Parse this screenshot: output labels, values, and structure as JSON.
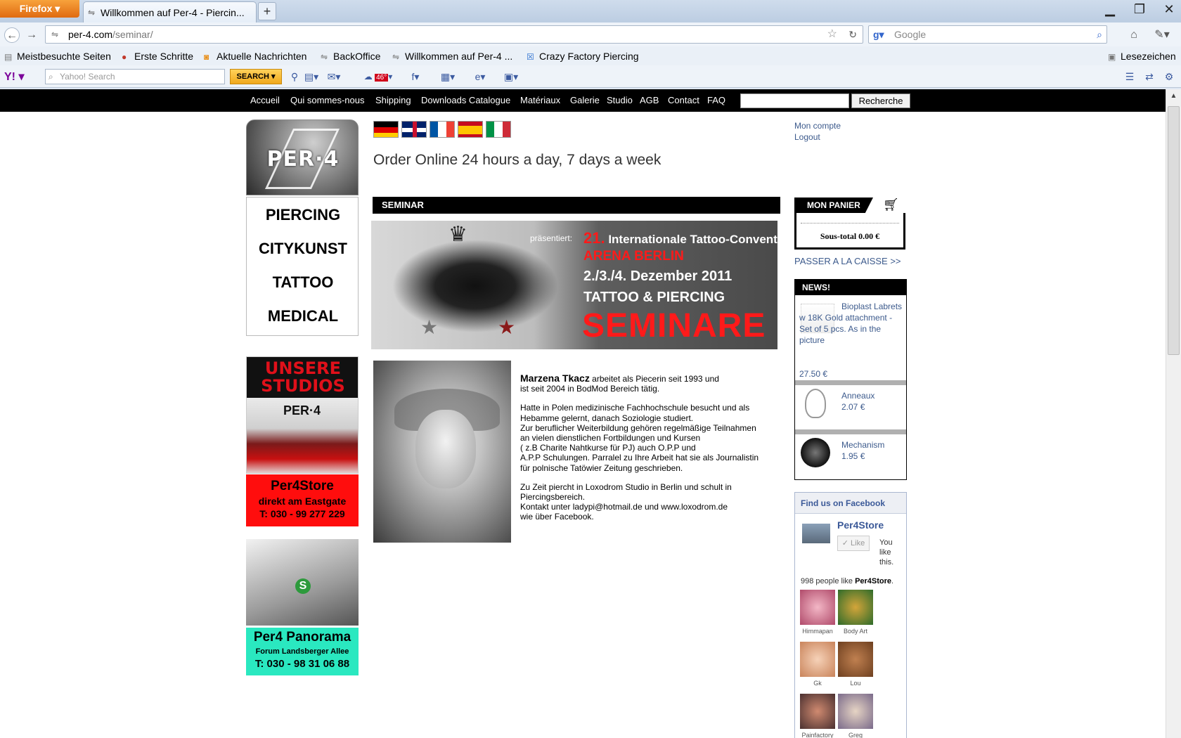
{
  "browser": {
    "app_button": "Firefox",
    "tab_title": "Willkommen auf Per-4 - Piercin...",
    "url_domain": "per-4.com",
    "url_path": "/seminar/",
    "search_engine_placeholder": "Google",
    "bookmarks": [
      {
        "label": "Meistbesuchte Seiten"
      },
      {
        "label": "Erste Schritte"
      },
      {
        "label": "Aktuelle Nachrichten"
      },
      {
        "label": "BackOffice"
      },
      {
        "label": "Willkommen auf Per-4 ..."
      },
      {
        "label": "Crazy Factory Piercing"
      }
    ],
    "bookmarks_menu": "Lesezeichen",
    "yahoo": {
      "search_placeholder": "Yahoo! Search",
      "search_button": "SEARCH",
      "weather": "46°"
    }
  },
  "topnav": {
    "items": [
      "Accueil",
      "Qui sommes-nous",
      "Shipping",
      "Downloads Catalogue",
      "Matériaux",
      "Galerie",
      "Studio",
      "AGB",
      "Contact",
      "FAQ"
    ],
    "search_button": "Recherche"
  },
  "left": {
    "logo_text": "PER·4",
    "categories": [
      "PIERCING",
      "CITYKUNST",
      "TATTOO",
      "MEDICAL"
    ],
    "ad_studios": {
      "heading_line1": "UNSERE",
      "heading_line2": "STUDIOS",
      "sign": "PER·4"
    },
    "ad_store": {
      "name": "Per4Store",
      "subtitle": "direkt am Eastgate",
      "phone": "T: 030 - 99 277 229"
    },
    "ad_panorama": {
      "sign": "S",
      "name": "Per4 Panorama",
      "subtitle": "Forum Landsberger Allee",
      "phone": "T: 030 - 98 31 06 88"
    }
  },
  "center": {
    "tagline": "Order Online 24 hours a day, 7 days a week",
    "section_title": "SEMINAR",
    "banner": {
      "presents": "präsentiert:",
      "number": "21.",
      "convention": "Internationale Tattoo-Convention",
      "venue": "ARENA BERLIN",
      "dates": "2./3./4. Dezember 2011",
      "topic": "TATTOO & PIERCING",
      "headline": "SEMINARE"
    },
    "bio": {
      "name": "Marzena Tkacz",
      "p1_rest": " arbeitet als Piecerin seit 1993 und\nist seit 2004 in BodMod Bereich tätig.",
      "p2": "Hatte in Polen medizinische Fachhochschule besucht und als\n Hebamme gelernt, danach Soziologie studiert.\nZur beruflicher Weiterbildung gehören regelmäßige Teilnahmen\nan vielen dienstlichen Fortbildungen und Kursen\n( z.B Charite Nahtkurse für PJ)  auch O.P.P und\nA.P.P Schulungen. Parralel zu Ihre Arbeit hat sie als Journalistin\n für polnische Tatöwier Zeitung geschrieben.",
      "p3": "Zu Zeit piercht in Loxodrom Studio in Berlin und schult in\nPiercingsbereich.\nKontakt unter ladypi@hotmail.de und www.loxodrom.de\nwie über Facebook."
    }
  },
  "right": {
    "account": [
      "Mon compte",
      "Logout"
    ],
    "cart_title": "MON PANIER",
    "subtotal": "Sous-total 0.00 €",
    "checkout": "PASSER A LA CAISSE >>",
    "news_title": "NEWS!",
    "news": [
      {
        "title": "Bioplast Labrets w 18K Gold attachment - Set of 5 pcs. As in the picture",
        "price": "27.50 €"
      },
      {
        "title": "Anneaux",
        "price": "2.07 €"
      },
      {
        "title": "Mechanism",
        "price": "1.95 €"
      }
    ],
    "facebook": {
      "title": "Find us on Facebook",
      "page_name": "Per4Store",
      "like_label": "Like",
      "you_like": "You like this.",
      "count_prefix": "998 people like ",
      "count_page": "Per4Store",
      "count_suffix": ".",
      "fans": [
        "Himmapan",
        "Body Art",
        "Gk",
        "Lou",
        "Painfactory",
        "Greg"
      ]
    }
  }
}
